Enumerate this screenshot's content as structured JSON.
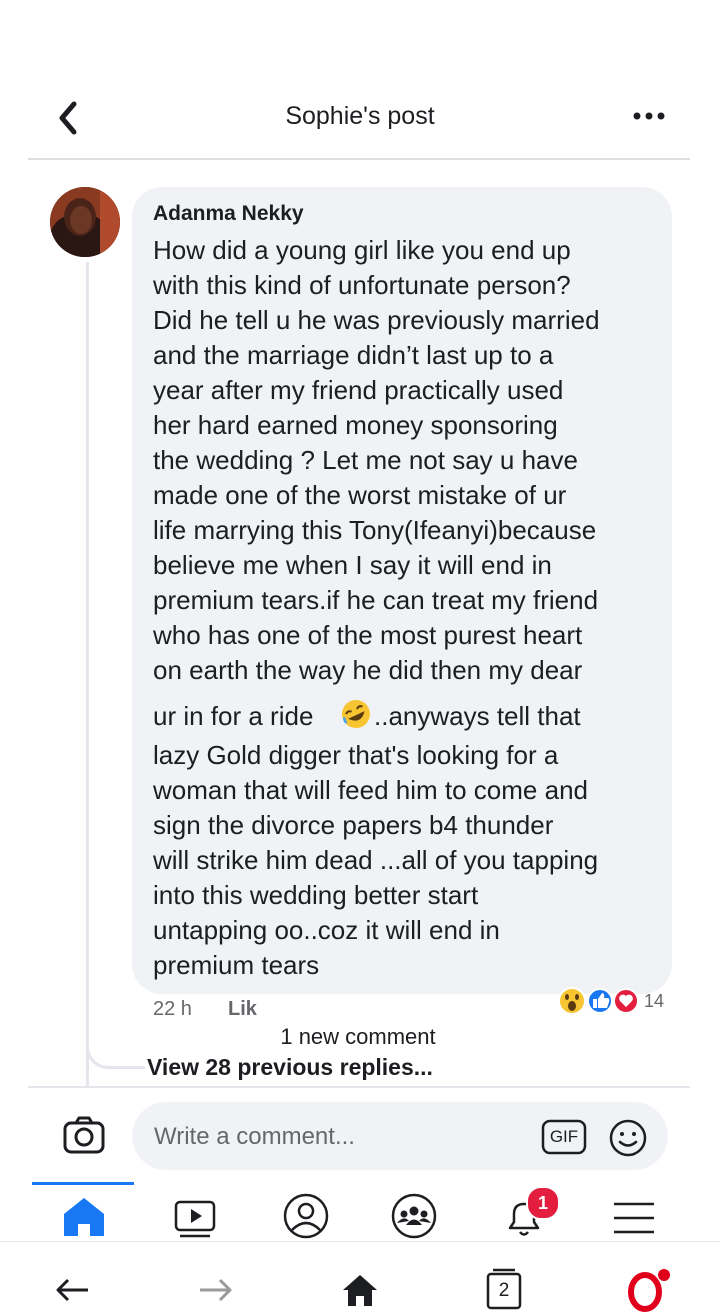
{
  "header": {
    "title": "Sophie's post",
    "back_icon": "chevron-left-icon",
    "more_icon": "more-horizontal-icon"
  },
  "comment": {
    "author": "Adanma Nekky",
    "lines": [
      "How did a young girl like you end up",
      "with this kind of unfortunate person?",
      "Did he tell u he was previously married",
      "and the marriage didn’t last up to a",
      "year after my friend practically used",
      "her hard earned money sponsoring",
      "the wedding ? Let me not say u have",
      "made one of the worst mistake of ur",
      "life marrying this Tony(Ifeanyi)because",
      "believe me when I say it will end in",
      "premium tears.if he can treat my friend",
      "who has one of the most purest heart",
      "on earth the way he did then my dear",
      "ur in for a ride",
      "..anyways tell that",
      "lazy Gold digger that's looking for a",
      "woman that will feed him to come and",
      "sign the divorce papers b4 thunder",
      "will strike him dead ...all of you tapping",
      "into this wedding better start",
      "untapping oo..coz it will end in",
      "premium tears"
    ],
    "inline_emoji": "rolling-on-floor-laughing-emoji",
    "time": "22 h",
    "like_label": "Lik",
    "reaction_count": "14",
    "reactions": [
      "wow-reaction-icon",
      "like-reaction-icon",
      "love-reaction-icon"
    ]
  },
  "new_comment_label": "1 new comment",
  "view_replies_label": "View 28 previous replies...",
  "composer": {
    "placeholder": "Write a comment...",
    "gif_label": "GIF"
  },
  "tabs": [
    {
      "name": "home",
      "icon": "home-icon",
      "active": true
    },
    {
      "name": "watch",
      "icon": "video-icon"
    },
    {
      "name": "profile",
      "icon": "profile-icon"
    },
    {
      "name": "groups",
      "icon": "groups-icon"
    },
    {
      "name": "notifications",
      "icon": "bell-icon",
      "badge": "1"
    },
    {
      "name": "menu",
      "icon": "menu-icon"
    }
  ],
  "browser": {
    "tab_count": "2"
  },
  "colors": {
    "accent": "#1877f2",
    "badge": "#e41e3f",
    "opera": "#e0001b"
  }
}
